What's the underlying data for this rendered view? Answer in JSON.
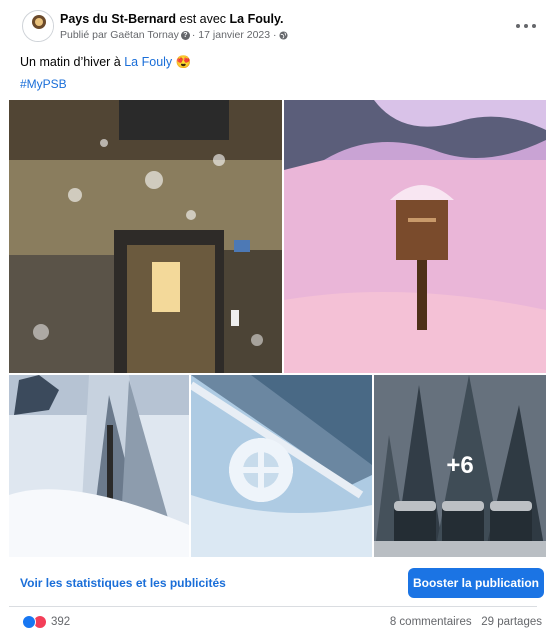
{
  "post": {
    "author": "Pays du St-Bernard",
    "with_word": "est avec",
    "tagged": "La Fouly.",
    "published_by": "Publié par Gaëtan Tornay",
    "date": "· 17 janvier 2023 ·",
    "avatar_label": "Pays du St-Bernard",
    "text_prefix": "Un matin d’hiver à",
    "text_link": "La Fouly",
    "text_emoji": "😍",
    "hashtag": "#MyPSB"
  },
  "gallery": {
    "extra_photos": "+6"
  },
  "actions": {
    "stats_link": "Voir les statistiques et les publicités",
    "boost_button": "Booster la publication"
  },
  "engagement": {
    "reaction_count": "392",
    "comments": "8 commentaires",
    "shares": "29 partages"
  },
  "icons": {
    "reaction_like": "like-icon",
    "reaction_love": "love-icon",
    "privacy": "globe-icon",
    "more": "ellipsis-icon"
  },
  "colors": {
    "link": "#1a6ed8",
    "button": "#1b74e4",
    "muted": "#65676b"
  }
}
